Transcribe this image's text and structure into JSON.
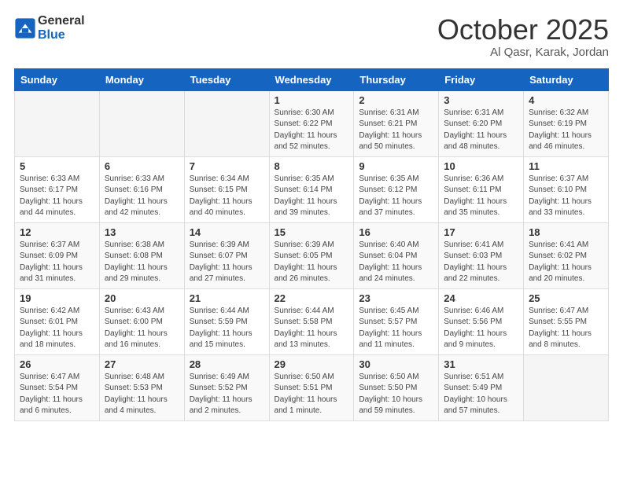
{
  "header": {
    "logo_general": "General",
    "logo_blue": "Blue",
    "month_title": "October 2025",
    "location": "Al Qasr, Karak, Jordan"
  },
  "weekdays": [
    "Sunday",
    "Monday",
    "Tuesday",
    "Wednesday",
    "Thursday",
    "Friday",
    "Saturday"
  ],
  "weeks": [
    [
      {
        "day": "",
        "sunrise": "",
        "sunset": "",
        "daylight": ""
      },
      {
        "day": "",
        "sunrise": "",
        "sunset": "",
        "daylight": ""
      },
      {
        "day": "",
        "sunrise": "",
        "sunset": "",
        "daylight": ""
      },
      {
        "day": "1",
        "sunrise": "Sunrise: 6:30 AM",
        "sunset": "Sunset: 6:22 PM",
        "daylight": "Daylight: 11 hours and 52 minutes."
      },
      {
        "day": "2",
        "sunrise": "Sunrise: 6:31 AM",
        "sunset": "Sunset: 6:21 PM",
        "daylight": "Daylight: 11 hours and 50 minutes."
      },
      {
        "day": "3",
        "sunrise": "Sunrise: 6:31 AM",
        "sunset": "Sunset: 6:20 PM",
        "daylight": "Daylight: 11 hours and 48 minutes."
      },
      {
        "day": "4",
        "sunrise": "Sunrise: 6:32 AM",
        "sunset": "Sunset: 6:19 PM",
        "daylight": "Daylight: 11 hours and 46 minutes."
      }
    ],
    [
      {
        "day": "5",
        "sunrise": "Sunrise: 6:33 AM",
        "sunset": "Sunset: 6:17 PM",
        "daylight": "Daylight: 11 hours and 44 minutes."
      },
      {
        "day": "6",
        "sunrise": "Sunrise: 6:33 AM",
        "sunset": "Sunset: 6:16 PM",
        "daylight": "Daylight: 11 hours and 42 minutes."
      },
      {
        "day": "7",
        "sunrise": "Sunrise: 6:34 AM",
        "sunset": "Sunset: 6:15 PM",
        "daylight": "Daylight: 11 hours and 40 minutes."
      },
      {
        "day": "8",
        "sunrise": "Sunrise: 6:35 AM",
        "sunset": "Sunset: 6:14 PM",
        "daylight": "Daylight: 11 hours and 39 minutes."
      },
      {
        "day": "9",
        "sunrise": "Sunrise: 6:35 AM",
        "sunset": "Sunset: 6:12 PM",
        "daylight": "Daylight: 11 hours and 37 minutes."
      },
      {
        "day": "10",
        "sunrise": "Sunrise: 6:36 AM",
        "sunset": "Sunset: 6:11 PM",
        "daylight": "Daylight: 11 hours and 35 minutes."
      },
      {
        "day": "11",
        "sunrise": "Sunrise: 6:37 AM",
        "sunset": "Sunset: 6:10 PM",
        "daylight": "Daylight: 11 hours and 33 minutes."
      }
    ],
    [
      {
        "day": "12",
        "sunrise": "Sunrise: 6:37 AM",
        "sunset": "Sunset: 6:09 PM",
        "daylight": "Daylight: 11 hours and 31 minutes."
      },
      {
        "day": "13",
        "sunrise": "Sunrise: 6:38 AM",
        "sunset": "Sunset: 6:08 PM",
        "daylight": "Daylight: 11 hours and 29 minutes."
      },
      {
        "day": "14",
        "sunrise": "Sunrise: 6:39 AM",
        "sunset": "Sunset: 6:07 PM",
        "daylight": "Daylight: 11 hours and 27 minutes."
      },
      {
        "day": "15",
        "sunrise": "Sunrise: 6:39 AM",
        "sunset": "Sunset: 6:05 PM",
        "daylight": "Daylight: 11 hours and 26 minutes."
      },
      {
        "day": "16",
        "sunrise": "Sunrise: 6:40 AM",
        "sunset": "Sunset: 6:04 PM",
        "daylight": "Daylight: 11 hours and 24 minutes."
      },
      {
        "day": "17",
        "sunrise": "Sunrise: 6:41 AM",
        "sunset": "Sunset: 6:03 PM",
        "daylight": "Daylight: 11 hours and 22 minutes."
      },
      {
        "day": "18",
        "sunrise": "Sunrise: 6:41 AM",
        "sunset": "Sunset: 6:02 PM",
        "daylight": "Daylight: 11 hours and 20 minutes."
      }
    ],
    [
      {
        "day": "19",
        "sunrise": "Sunrise: 6:42 AM",
        "sunset": "Sunset: 6:01 PM",
        "daylight": "Daylight: 11 hours and 18 minutes."
      },
      {
        "day": "20",
        "sunrise": "Sunrise: 6:43 AM",
        "sunset": "Sunset: 6:00 PM",
        "daylight": "Daylight: 11 hours and 16 minutes."
      },
      {
        "day": "21",
        "sunrise": "Sunrise: 6:44 AM",
        "sunset": "Sunset: 5:59 PM",
        "daylight": "Daylight: 11 hours and 15 minutes."
      },
      {
        "day": "22",
        "sunrise": "Sunrise: 6:44 AM",
        "sunset": "Sunset: 5:58 PM",
        "daylight": "Daylight: 11 hours and 13 minutes."
      },
      {
        "day": "23",
        "sunrise": "Sunrise: 6:45 AM",
        "sunset": "Sunset: 5:57 PM",
        "daylight": "Daylight: 11 hours and 11 minutes."
      },
      {
        "day": "24",
        "sunrise": "Sunrise: 6:46 AM",
        "sunset": "Sunset: 5:56 PM",
        "daylight": "Daylight: 11 hours and 9 minutes."
      },
      {
        "day": "25",
        "sunrise": "Sunrise: 6:47 AM",
        "sunset": "Sunset: 5:55 PM",
        "daylight": "Daylight: 11 hours and 8 minutes."
      }
    ],
    [
      {
        "day": "26",
        "sunrise": "Sunrise: 6:47 AM",
        "sunset": "Sunset: 5:54 PM",
        "daylight": "Daylight: 11 hours and 6 minutes."
      },
      {
        "day": "27",
        "sunrise": "Sunrise: 6:48 AM",
        "sunset": "Sunset: 5:53 PM",
        "daylight": "Daylight: 11 hours and 4 minutes."
      },
      {
        "day": "28",
        "sunrise": "Sunrise: 6:49 AM",
        "sunset": "Sunset: 5:52 PM",
        "daylight": "Daylight: 11 hours and 2 minutes."
      },
      {
        "day": "29",
        "sunrise": "Sunrise: 6:50 AM",
        "sunset": "Sunset: 5:51 PM",
        "daylight": "Daylight: 11 hours and 1 minute."
      },
      {
        "day": "30",
        "sunrise": "Sunrise: 6:50 AM",
        "sunset": "Sunset: 5:50 PM",
        "daylight": "Daylight: 10 hours and 59 minutes."
      },
      {
        "day": "31",
        "sunrise": "Sunrise: 6:51 AM",
        "sunset": "Sunset: 5:49 PM",
        "daylight": "Daylight: 10 hours and 57 minutes."
      },
      {
        "day": "",
        "sunrise": "",
        "sunset": "",
        "daylight": ""
      }
    ]
  ]
}
